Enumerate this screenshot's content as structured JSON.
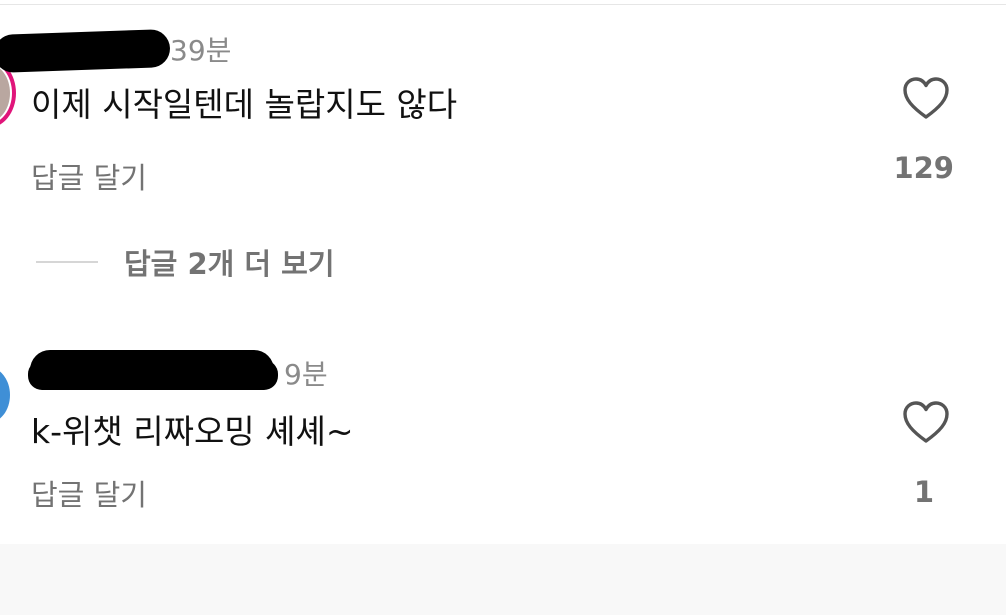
{
  "comments": [
    {
      "time": "39분",
      "text": "이제 시작일텐데 놀랍지도 않다",
      "reply_label": "답글 달기",
      "like_count": "129",
      "view_more_label": "답글 2개 더 보기"
    },
    {
      "time": "9분",
      "text": "k-위챗 리짜오밍 셰셰~",
      "reply_label": "답글 달기",
      "like_count": "1"
    }
  ],
  "icons": {
    "like": "heart-outline-icon"
  },
  "colors": {
    "avatar_ring": "#e0157a",
    "avatar_2": "#3f8fd6",
    "muted_text": "#737373"
  }
}
